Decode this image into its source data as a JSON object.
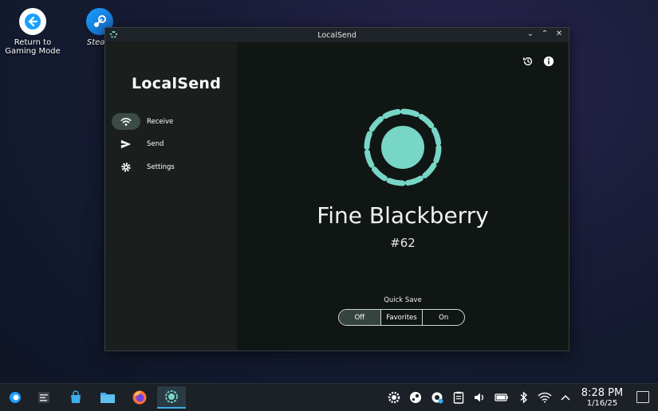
{
  "desktop": {
    "icons": [
      {
        "label": "Return to Gaming Mode",
        "icon": "return-arrow-icon"
      },
      {
        "label": "Steam",
        "icon": "steam-icon"
      }
    ]
  },
  "window": {
    "title": "LocalSend",
    "controls": [
      "minimize-icon",
      "maximize-icon",
      "close-icon"
    ]
  },
  "sidebar": {
    "brand": "LocalSend",
    "items": [
      {
        "label": "Receive",
        "icon": "wifi-icon",
        "active": true
      },
      {
        "label": "Send",
        "icon": "send-icon",
        "active": false
      },
      {
        "label": "Settings",
        "icon": "gear-icon",
        "active": false
      }
    ]
  },
  "main": {
    "top_icons": [
      "history-icon",
      "info-icon"
    ],
    "device_name": "Fine Blackberry",
    "device_id": "#62",
    "quick_save": {
      "label": "Quick Save",
      "options": [
        "Off",
        "Favorites",
        "On"
      ],
      "selected": "Off"
    }
  },
  "taskbar": {
    "apps": [
      "steamos-menu-icon",
      "task-manager-icon",
      "discover-store-icon",
      "file-manager-icon",
      "firefox-icon",
      "localsend-icon"
    ],
    "active_app": "localsend-icon",
    "tray": [
      "steam-gear-icon",
      "steam-icon",
      "steam-update-icon",
      "clipboard-icon",
      "volume-icon",
      "battery-icon",
      "bluetooth-icon",
      "wifi-icon",
      "chevron-up-icon"
    ],
    "clock": {
      "time": "8:28 PM",
      "date": "1/16/25"
    }
  },
  "colors": {
    "accent": "#78d6c6",
    "window_bg": "#101614",
    "sidebar_bg": "#1a1f1d",
    "selected": "#354441"
  }
}
